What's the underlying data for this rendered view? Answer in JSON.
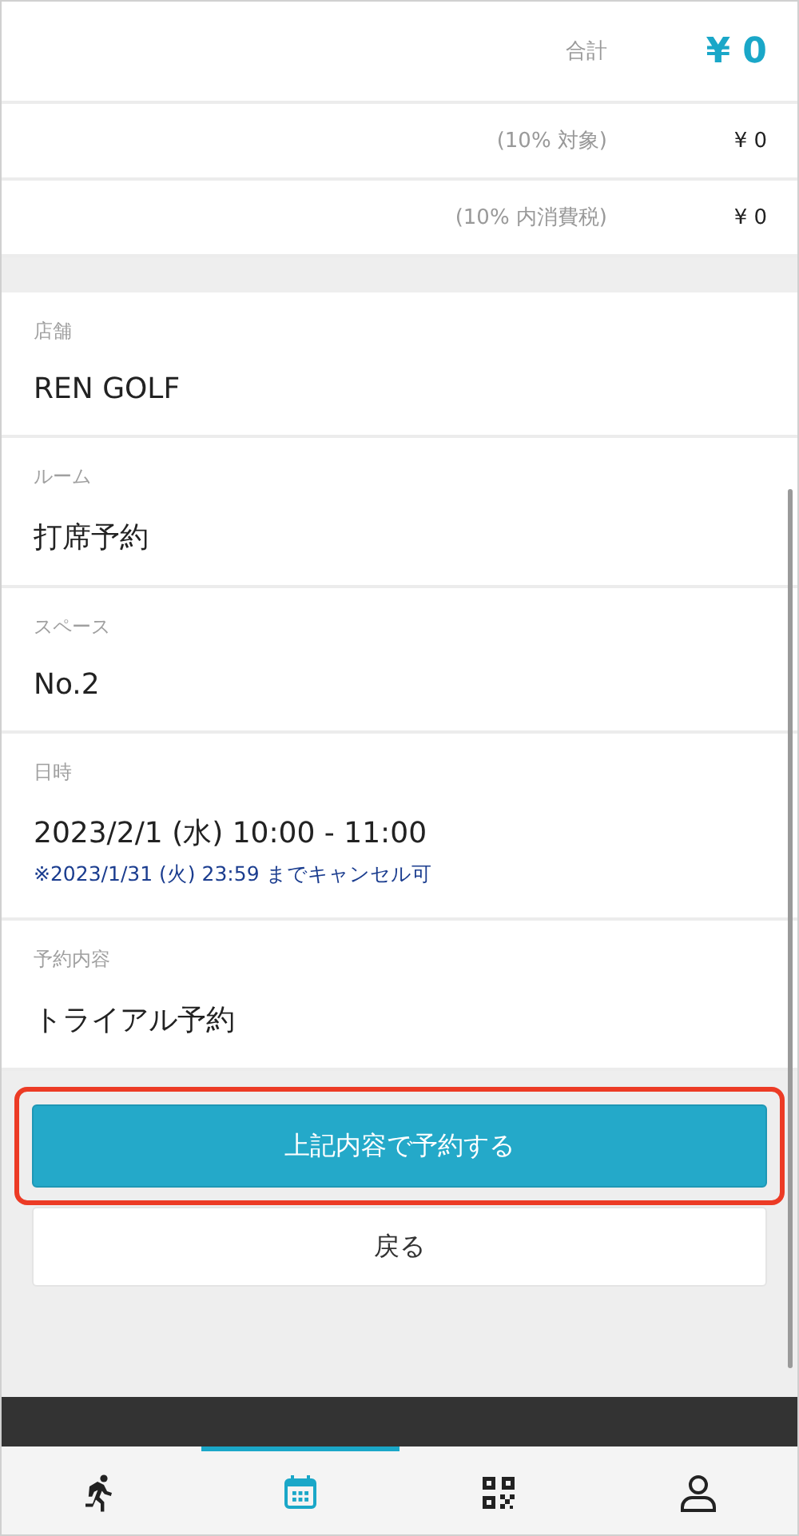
{
  "summary": {
    "total": {
      "label": "合計",
      "value": "¥ 0"
    },
    "rows": [
      {
        "label": "(10% 対象)",
        "value": "¥ 0"
      },
      {
        "label": "(10% 内消費税)",
        "value": "¥ 0"
      }
    ]
  },
  "details": [
    {
      "label": "店舗",
      "value": "REN GOLF"
    },
    {
      "label": "ルーム",
      "value": "打席予約"
    },
    {
      "label": "スペース",
      "value": "No.2"
    },
    {
      "label": "日時",
      "value": "2023/2/1 (水) 10:00 - 11:00",
      "note": "※2023/1/31 (火) 23:59 までキャンセル可"
    },
    {
      "label": "予約内容",
      "value": "トライアル予約"
    }
  ],
  "actions": [
    {
      "kind": "primary",
      "label": "上記内容で予約する",
      "highlighted": true
    },
    {
      "kind": "secondary",
      "label": "戻る",
      "highlighted": false
    }
  ],
  "tabs": [
    {
      "kind": "runner",
      "selected": false
    },
    {
      "kind": "calendar",
      "selected": true
    },
    {
      "kind": "qr",
      "selected": false
    },
    {
      "kind": "person",
      "selected": false
    }
  ]
}
